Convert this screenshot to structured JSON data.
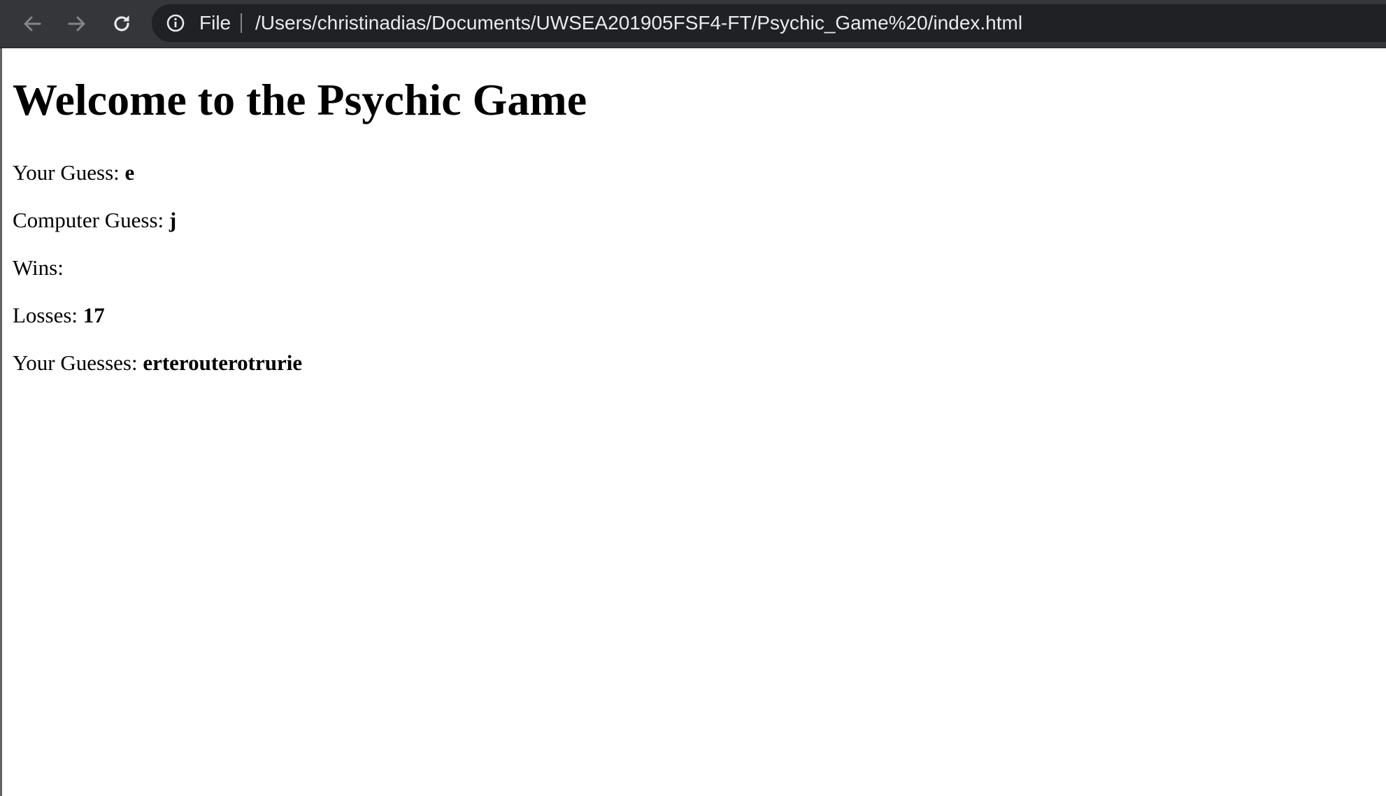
{
  "browser": {
    "scheme_chip": "File",
    "url": "/Users/christinadias/Documents/UWSEA201905FSF4-FT/Psychic_Game%20/index.html",
    "icons": {
      "back": "arrow-left-icon",
      "forward": "arrow-right-icon",
      "reload": "reload-icon",
      "site_info": "info-circle-icon"
    },
    "colors": {
      "toolbar": "#35363a",
      "omnibox": "#202124",
      "text": "#e8eaed"
    }
  },
  "page": {
    "title": "Welcome to the Psychic Game",
    "your_guess": {
      "label": "Your Guess: ",
      "value": "e"
    },
    "computer_guess": {
      "label": "Computer Guess: ",
      "value": "j"
    },
    "wins": {
      "label": "Wins: ",
      "value": ""
    },
    "losses": {
      "label": "Losses: ",
      "value": "17"
    },
    "guesses_so_far": {
      "label": "Your Guesses: ",
      "value": "erterouterotrurie"
    }
  }
}
